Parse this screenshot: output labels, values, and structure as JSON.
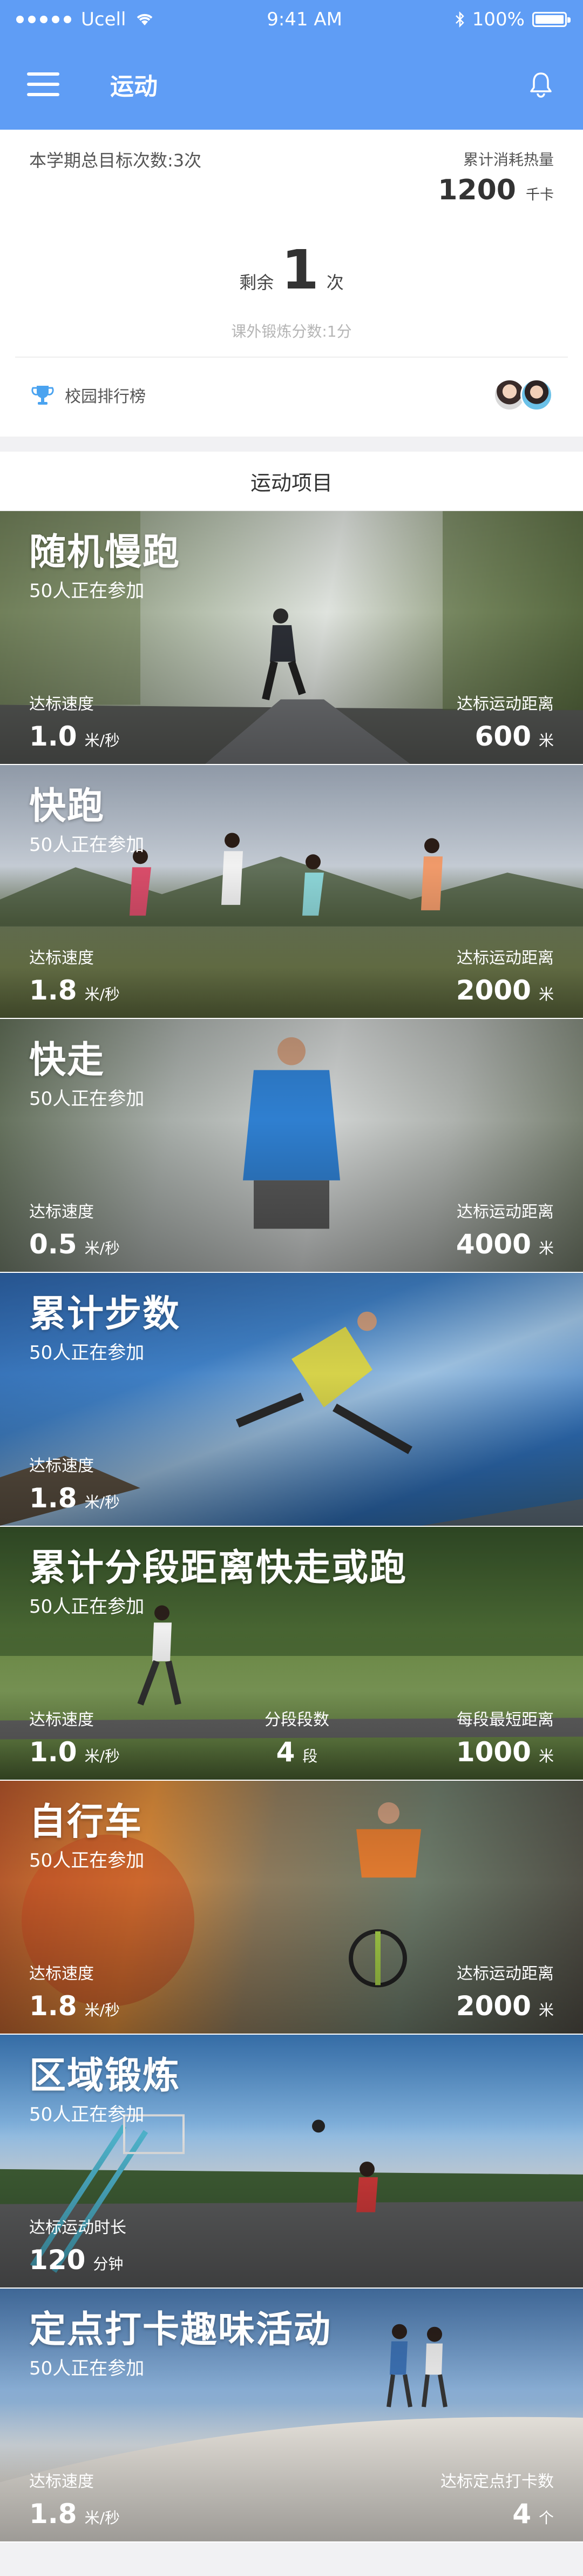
{
  "status_bar": {
    "carrier": "Ucell",
    "time": "9:41 AM",
    "battery": "100%"
  },
  "nav": {
    "title": "运动"
  },
  "stats": {
    "goal_text": "本学期总目标次数:3次",
    "calories_label": "累计消耗热量",
    "calories_value": "1200",
    "calories_unit": "千卡",
    "remaining_prefix": "剩余",
    "remaining_value": "1",
    "remaining_unit": "次",
    "score_text": "课外锻炼分数:1分",
    "ranking_label": "校园排行榜"
  },
  "section_title": "运动项目",
  "activities": [
    {
      "title": "随机慢跑",
      "participants": "50人正在参加",
      "left_label": "达标速度",
      "left_value": "1.0",
      "left_unit": "米/秒",
      "right_label": "达标运动距离",
      "right_value": "600",
      "right_unit": "米"
    },
    {
      "title": "快跑",
      "participants": "50人正在参加",
      "left_label": "达标速度",
      "left_value": "1.8",
      "left_unit": "米/秒",
      "right_label": "达标运动距离",
      "right_value": "2000",
      "right_unit": "米"
    },
    {
      "title": "快走",
      "participants": "50人正在参加",
      "left_label": "达标速度",
      "left_value": "0.5",
      "left_unit": "米/秒",
      "right_label": "达标运动距离",
      "right_value": "4000",
      "right_unit": "米"
    },
    {
      "title": "累计步数",
      "participants": "50人正在参加",
      "left_label": "达标速度",
      "left_value": "1.8",
      "left_unit": "米/秒"
    },
    {
      "title": "累计分段距离快走或跑",
      "participants": "50人正在参加",
      "left_label": "达标速度",
      "left_value": "1.0",
      "left_unit": "米/秒",
      "mid_label": "分段段数",
      "mid_value": "4",
      "mid_unit": "段",
      "right_label": "每段最短距离",
      "right_value": "1000",
      "right_unit": "米"
    },
    {
      "title": "自行车",
      "participants": "50人正在参加",
      "left_label": "达标速度",
      "left_value": "1.8",
      "left_unit": "米/秒",
      "right_label": "达标运动距离",
      "right_value": "2000",
      "right_unit": "米"
    },
    {
      "title": "区域锻炼",
      "participants": "50人正在参加",
      "left_label": "达标运动时长",
      "left_value": "120",
      "left_unit": "分钟"
    },
    {
      "title": "定点打卡趣味活动",
      "participants": "50人正在参加",
      "left_label": "达标速度",
      "left_value": "1.8",
      "left_unit": "米/秒",
      "right_label": "达标定点打卡数",
      "right_value": "4",
      "right_unit": "个"
    }
  ],
  "colors": {
    "header_blue": "#5f9df5",
    "trophy_blue": "#4aa3f0"
  },
  "icons": {
    "menu": "menu-icon",
    "bell": "bell-icon",
    "trophy": "trophy-icon",
    "wifi": "wifi-icon",
    "bluetooth": "bluetooth-icon",
    "battery": "battery-icon"
  }
}
